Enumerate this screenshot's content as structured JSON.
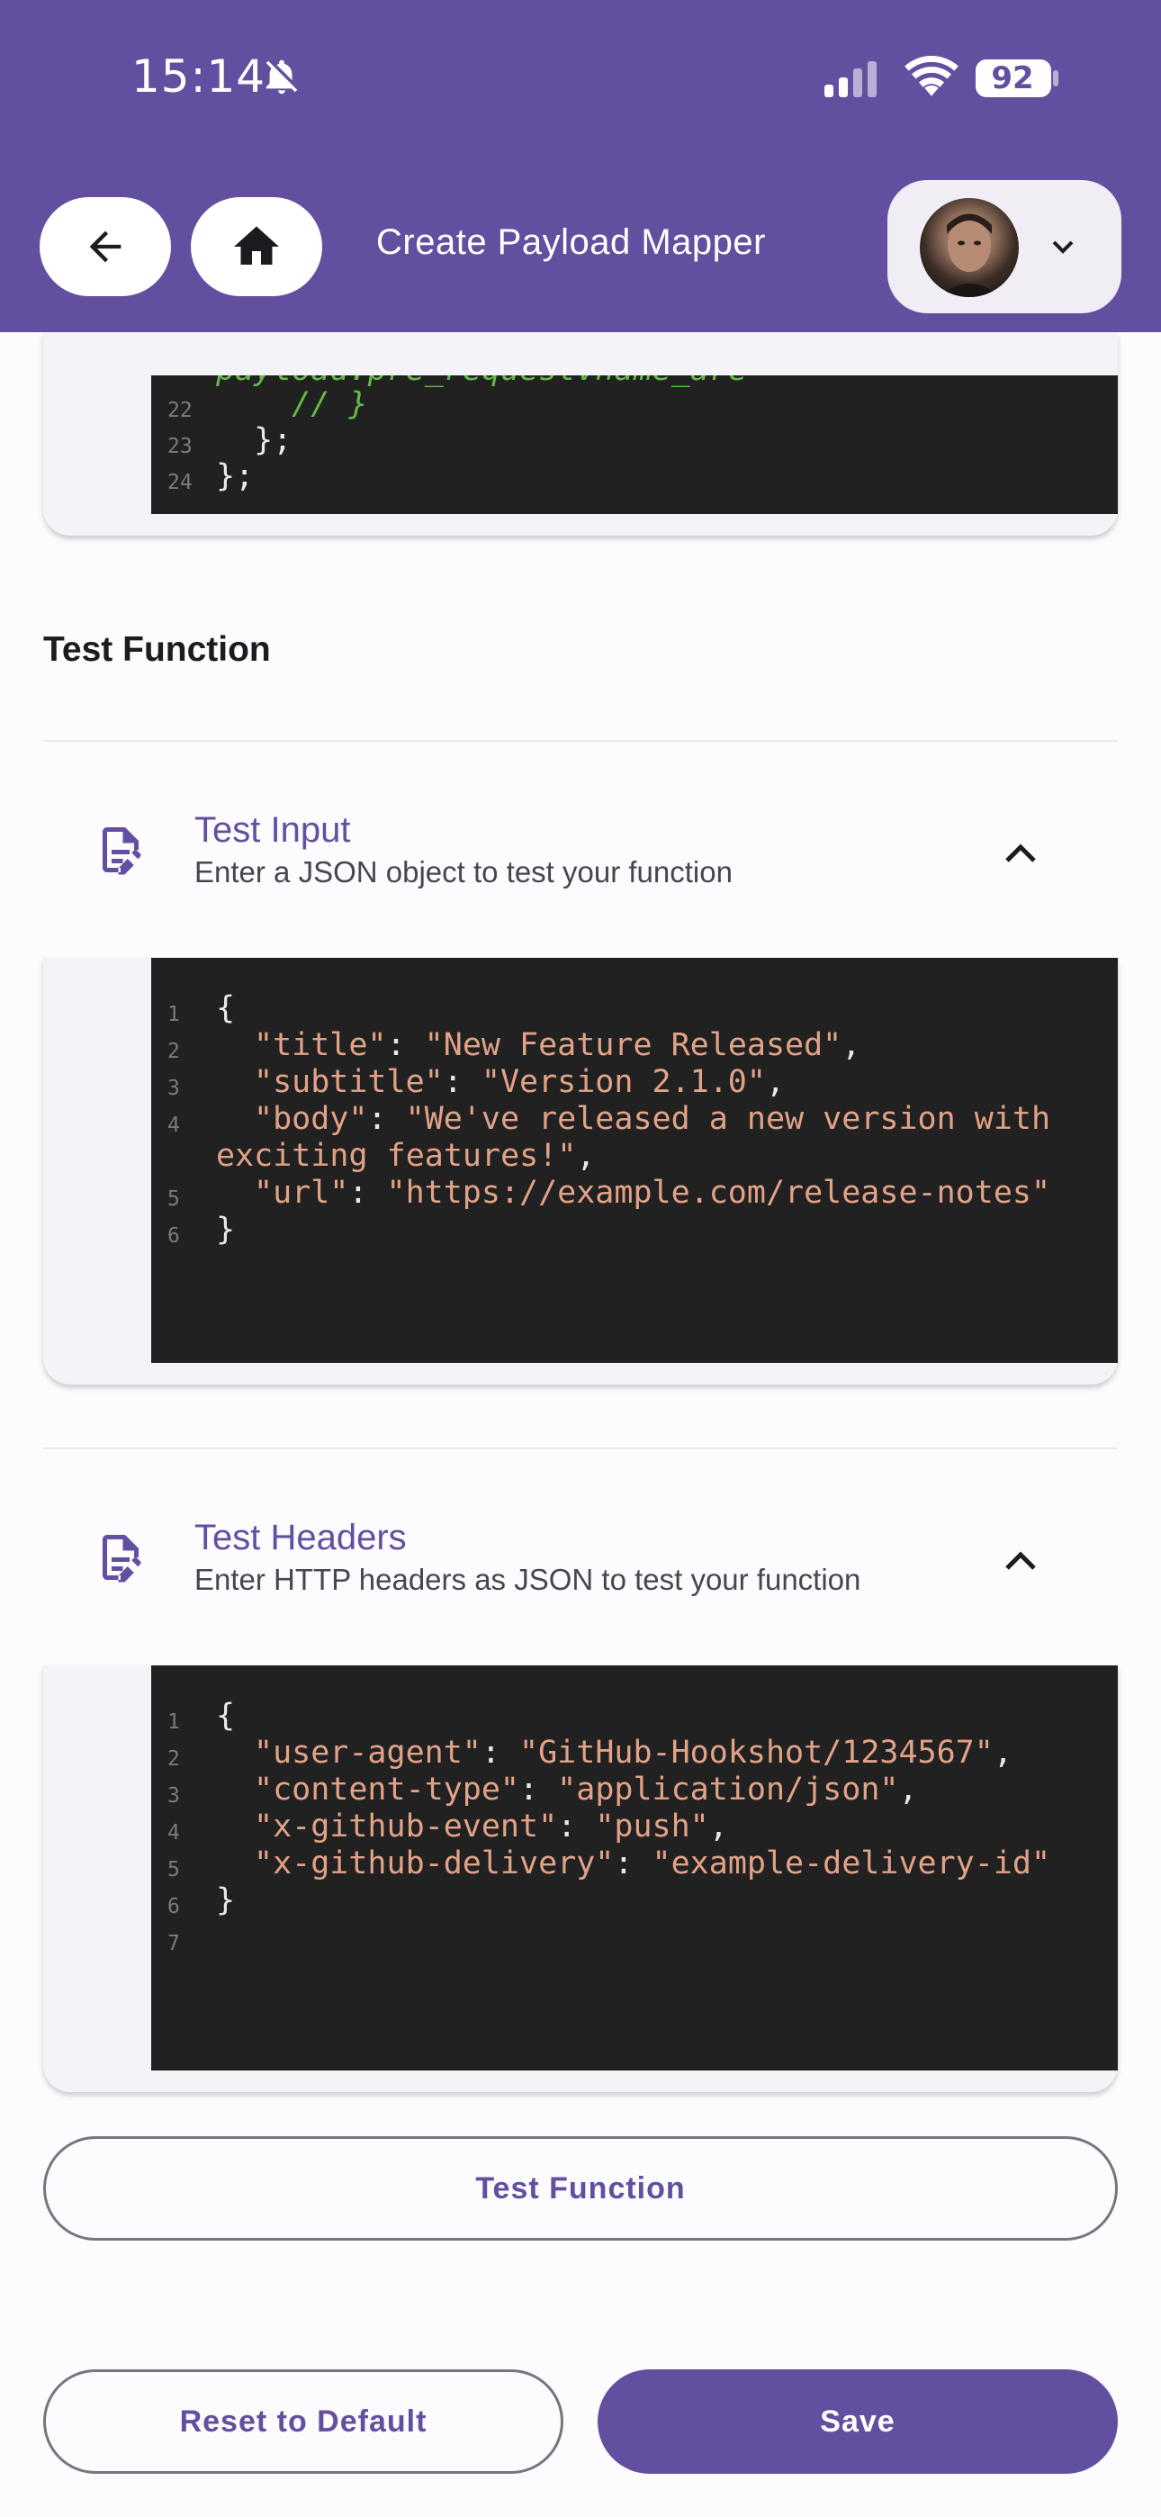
{
  "status_bar": {
    "time": "15:14",
    "battery": "92"
  },
  "header": {
    "title": "Create Payload Mapper"
  },
  "top_code": {
    "lines": [
      {
        "n": "",
        "text": "payload.pre_requestVname_are"
      },
      {
        "n": "22",
        "text": "    // }"
      },
      {
        "n": "23",
        "text": "  };"
      },
      {
        "n": "24",
        "text": "};"
      }
    ]
  },
  "test_section": {
    "label": "Test Function"
  },
  "test_input": {
    "title": "Test Input",
    "subtitle": "Enter a JSON object to test your function",
    "lines": [
      {
        "n": "1",
        "text": "{"
      },
      {
        "n": "2",
        "key": "\"title\"",
        "val": "\"New Feature Released\"",
        "tail": ","
      },
      {
        "n": "3",
        "key": "\"subtitle\"",
        "val": "\"Version 2.1.0\"",
        "tail": ","
      },
      {
        "n": "4",
        "key": "\"body\"",
        "val": "\"We've released a new version with"
      },
      {
        "n": "",
        "val_only": "exciting features!\"",
        "tail": ","
      },
      {
        "n": "5",
        "key": "\"url\"",
        "val": "\"https://example.com/release-notes\""
      },
      {
        "n": "6",
        "text": "}"
      }
    ]
  },
  "test_headers": {
    "title": "Test Headers",
    "subtitle": "Enter HTTP headers as JSON to test your function",
    "lines": [
      {
        "n": "1",
        "text": "{"
      },
      {
        "n": "2",
        "key": "\"user-agent\"",
        "val": "\"GitHub-Hookshot/1234567\"",
        "tail": ","
      },
      {
        "n": "3",
        "key": "\"content-type\"",
        "val": "\"application/json\"",
        "tail": ","
      },
      {
        "n": "4",
        "key": "\"x-github-event\"",
        "val": "\"push\"",
        "tail": ","
      },
      {
        "n": "5",
        "key": "\"x-github-delivery\"",
        "val": "\"example-delivery-id\""
      },
      {
        "n": "6",
        "text": "}"
      },
      {
        "n": "7",
        "text": ""
      }
    ]
  },
  "buttons": {
    "test_function": "Test Function",
    "reset": "Reset to Default",
    "save": "Save"
  },
  "colors": {
    "primary": "#634f9f",
    "code_bg": "#212121",
    "string": "#e2a287",
    "comment": "#63b947"
  },
  "icons": [
    "bell-off-icon",
    "signal-icon",
    "wifi-icon",
    "battery-icon",
    "arrow-back-icon",
    "home-icon",
    "chevron-down-icon",
    "edit-note-icon",
    "chevron-up-icon"
  ]
}
